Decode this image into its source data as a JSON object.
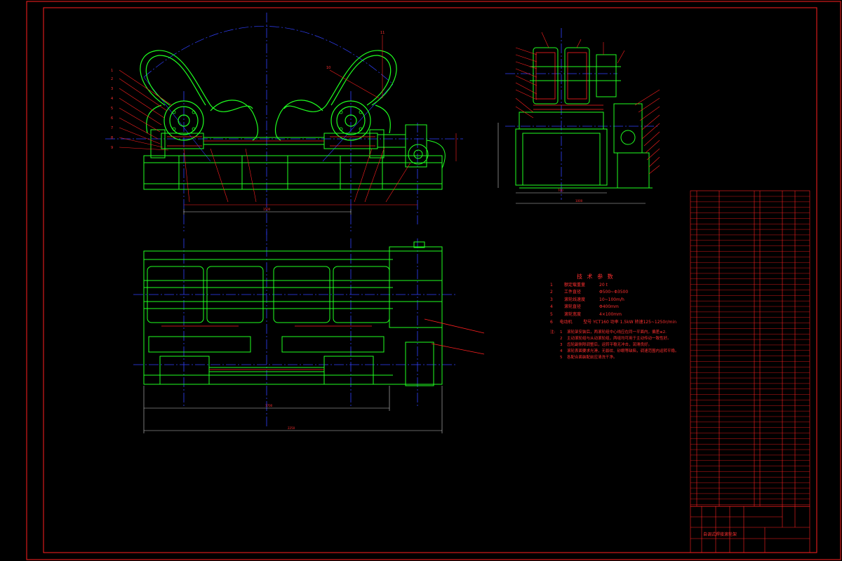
{
  "drawing": {
    "colors": {
      "frame": "#ff2020",
      "part": "#20ff20",
      "center": "#3040ff",
      "text": "#ff3030",
      "dim": "#c8c8c8"
    },
    "title_block_name": "自调式焊接滚轮架"
  },
  "tech_params": {
    "title": "技 术 参 数",
    "rows": [
      {
        "num": "1",
        "key": "额定载重量",
        "val": "20 t"
      },
      {
        "num": "2",
        "key": "工件直径",
        "val": "Φ500~Φ3500"
      },
      {
        "num": "3",
        "key": "滚轮线速度",
        "val": "10~100m/h"
      },
      {
        "num": "4",
        "key": "滚轮直径",
        "val": "Φ400mm"
      },
      {
        "num": "5",
        "key": "滚轮宽度",
        "val": "4×100mm"
      },
      {
        "num": "6",
        "key": "电动机",
        "val": "型号 YCT160  功率 1.5kW  转速125~1250r/min"
      }
    ]
  },
  "notes": {
    "head": "注:",
    "items": [
      {
        "num": "1",
        "text": "滚轮架安装后，两滚轮组中心线应在同一平面内，偏差≤2."
      },
      {
        "num": "2",
        "text": "主动滚轮组与从动滚轮组，两组均可用于主动传动一致性好。"
      },
      {
        "num": "3",
        "text": "齿轮副侧隙调整后，运转平稳无冲击，润滑良好。"
      },
      {
        "num": "4",
        "text": "滚轮表面要求光滑，无裂纹、砂眼等缺陷，调速范围内运转平稳。"
      },
      {
        "num": "5",
        "text": "各配合面装配前应清洗干净。"
      }
    ]
  }
}
